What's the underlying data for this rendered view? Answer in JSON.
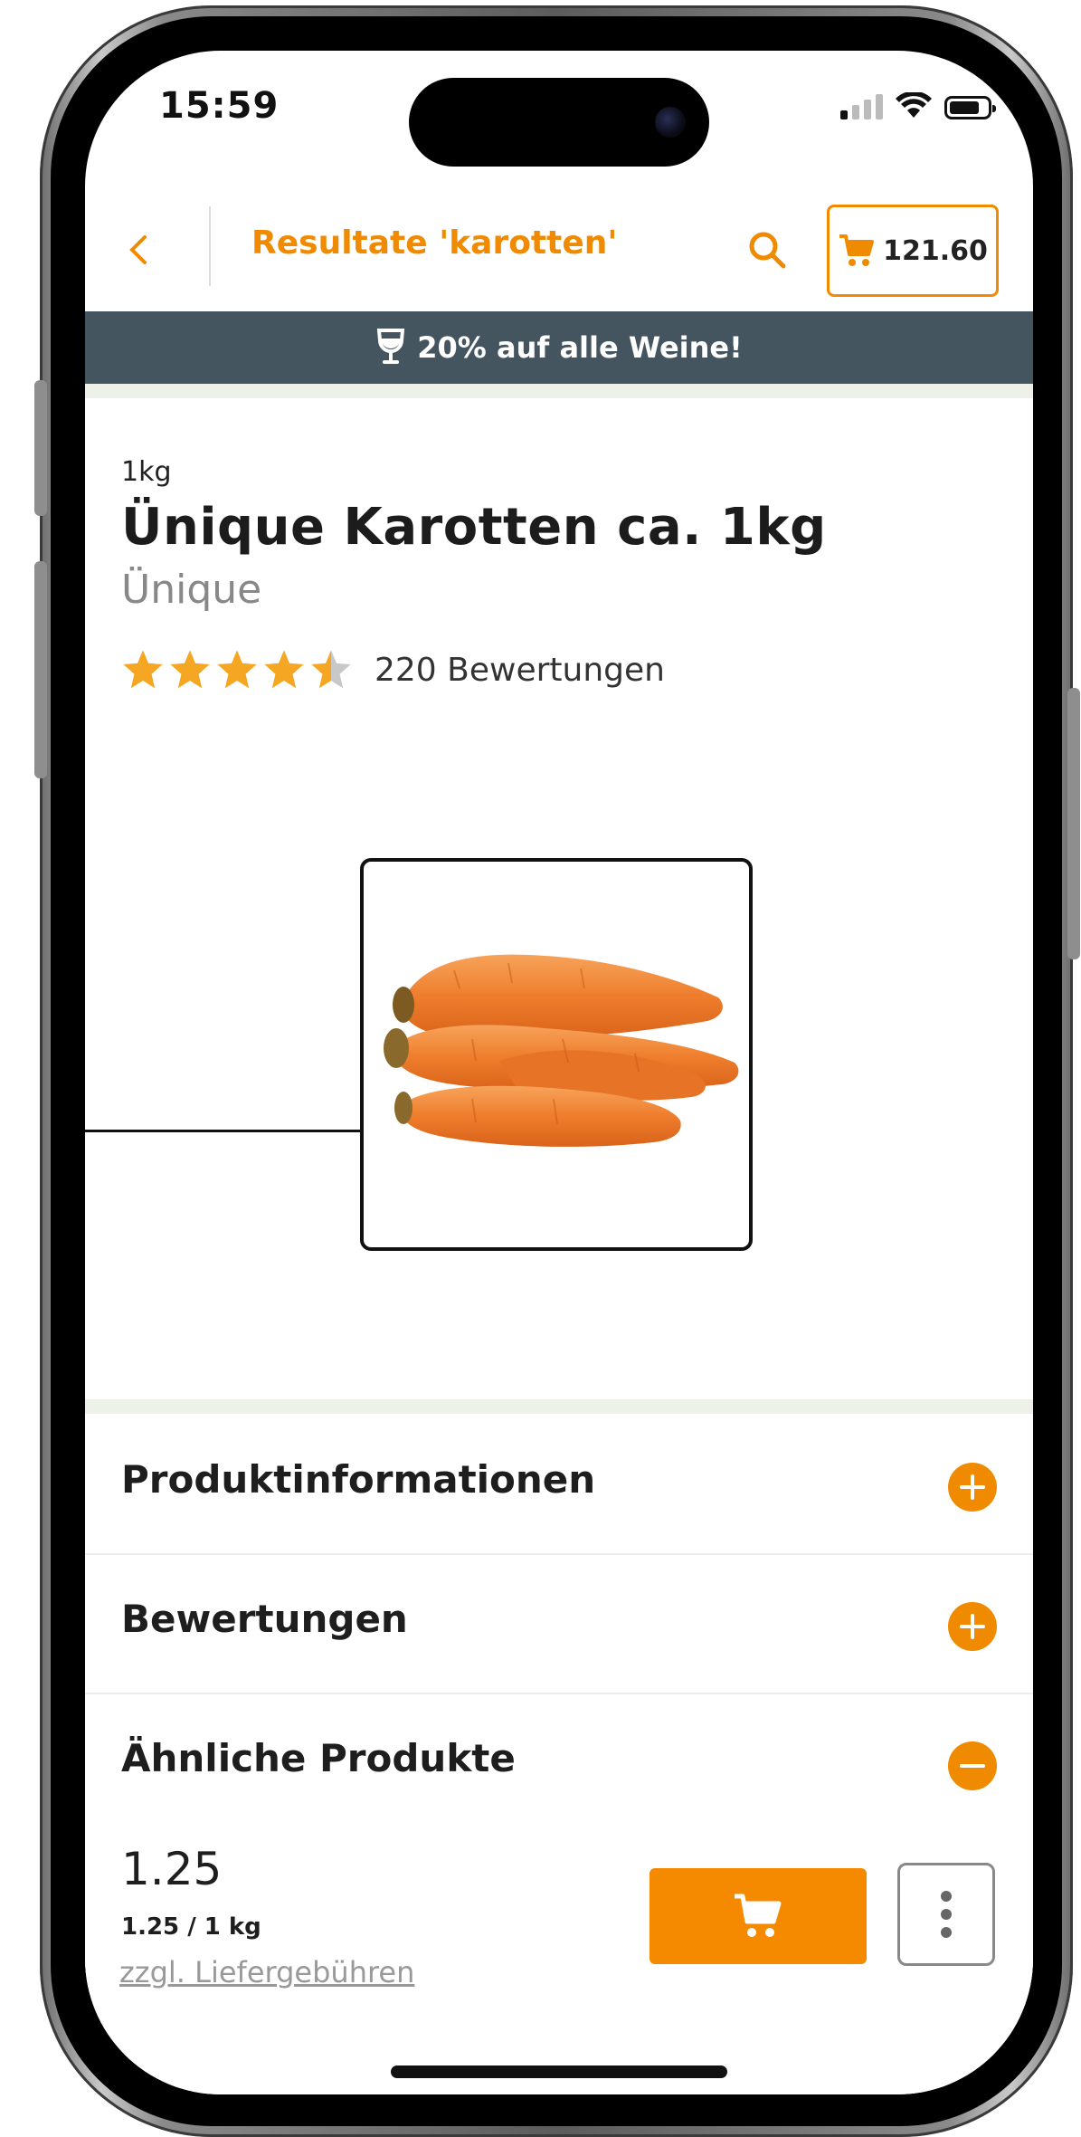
{
  "status_bar": {
    "time": "15:59"
  },
  "header": {
    "back_icon": "chevron-left-icon",
    "title": "Resultate 'karotten'",
    "search_icon": "search-icon",
    "cart_total": "121.60"
  },
  "promo": {
    "icon": "wine-glass-icon",
    "text": "20% auf alle Weine!"
  },
  "product": {
    "unit": "1kg",
    "title": "Ünique Karotten ca. 1kg",
    "brand": "Ünique",
    "rating_value": 4.5,
    "rating_max": 5,
    "reviews": "220 Bewertungen",
    "image": "carrots-image"
  },
  "accordion": [
    {
      "label": "Produktinformationen",
      "state": "collapsed"
    },
    {
      "label": "Bewertungen",
      "state": "collapsed"
    },
    {
      "label": "Ähnliche Produkte",
      "state": "expanded"
    }
  ],
  "footer": {
    "price": "1.25",
    "unit_price": "1.25 / 1 kg",
    "delivery_link": "zzgl. Liefergebühren",
    "cart_icon": "cart-icon",
    "more_icon": "more-vertical-icon"
  },
  "colors": {
    "accent": "#f08a00",
    "banner": "#455560",
    "star": "#f5a623"
  }
}
